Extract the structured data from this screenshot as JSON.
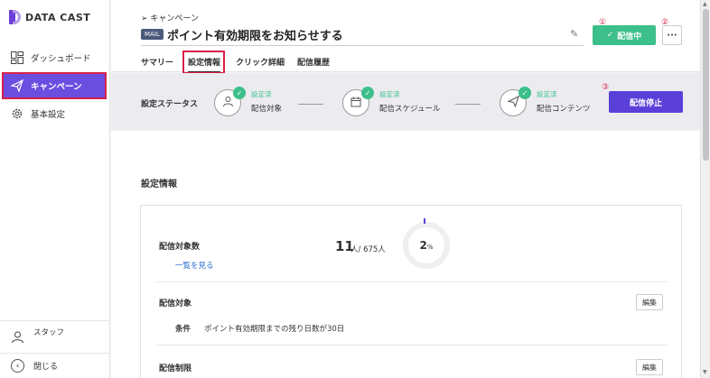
{
  "sidebar": {
    "brand": "DATA CAST",
    "items": [
      {
        "label": "ダッシュボード",
        "icon": "dashboard-grid-icon"
      },
      {
        "label": "キャンペーン",
        "icon": "paper-plane-icon"
      },
      {
        "label": "基本設定",
        "icon": "gear-icon"
      }
    ],
    "staff_label": "スタッフ",
    "close_label": "閉じる"
  },
  "header": {
    "breadcrumb": "キャンペーン",
    "badge": "MAIL",
    "title": "ポイント有効期限をお知らせする",
    "live_button": "配信中",
    "more_button": "···",
    "markers": [
      "①",
      "②",
      "③"
    ],
    "tabs": [
      {
        "label": "サマリー"
      },
      {
        "label": "設定情報"
      },
      {
        "label": "クリック詳細"
      },
      {
        "label": "配信履歴"
      }
    ]
  },
  "status": {
    "label": "設定ステータス",
    "steps": [
      {
        "state": "設定済",
        "name": "配信対象",
        "icon": "person-icon"
      },
      {
        "state": "設定済",
        "name": "配信スケジュール",
        "icon": "calendar-icon"
      },
      {
        "state": "設定済",
        "name": "配信コンテンツ",
        "icon": "paper-plane-icon"
      }
    ],
    "stop_button": "配信停止"
  },
  "settings": {
    "section_title": "設定情報",
    "target_count_label": "配信対象数",
    "view_list_link": "一覧を見る",
    "count": "11",
    "count_unit": "人/ 675人",
    "percent": "2",
    "percent_unit": "%",
    "target_label": "配信対象",
    "edit_label": "編集",
    "condition_key": "条件",
    "condition_value": "ポイント有効期限までの残り日数が30日",
    "limit_label": "配信制限"
  },
  "colors": {
    "accent": "#6a4ee0",
    "success": "#3cbf8a",
    "highlight": "#d8204a"
  }
}
